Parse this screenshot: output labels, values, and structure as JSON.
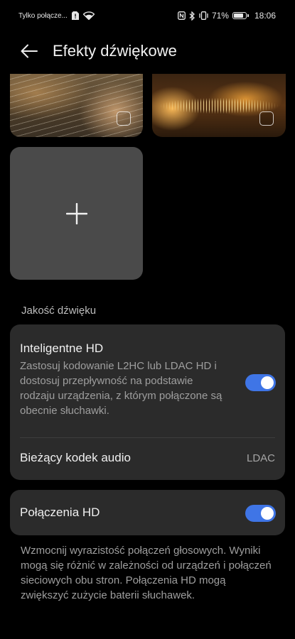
{
  "status_bar": {
    "carrier_text": "Tylko połącze...",
    "battery_percent": "71%",
    "battery_level": 0.71,
    "time": "18:06",
    "icons": [
      "sim-alert-icon",
      "wifi-icon",
      "nfc-icon",
      "bluetooth-icon",
      "vibrate-icon",
      "battery-icon"
    ]
  },
  "header": {
    "title": "Efekty dźwiękowe",
    "back_icon": "arrow-left-icon"
  },
  "effects": {
    "thumbnails": [
      {
        "name": "guitar-effect",
        "checked": false
      },
      {
        "name": "waveform-effect",
        "checked": false
      }
    ],
    "add_icon": "plus-icon"
  },
  "sound_quality": {
    "section_title": "Jakość dźwięku",
    "smart_hd": {
      "title": "Inteligentne HD",
      "description": "Zastosuj kodowanie L2HC lub LDAC HD i dostosuj przepływność na podstawie rodzaju urządzenia, z którym połączone są obecnie słuchawki.",
      "enabled": true
    },
    "codec": {
      "label": "Bieżący kodek audio",
      "value": "LDAC"
    }
  },
  "hd_calls": {
    "label": "Połączenia HD",
    "enabled": true,
    "note": "Wzmocnij wyrazistość połączeń głosowych. Wyniki mogą się różnić w zależności od urządzeń i połączeń sieciowych obu stron. Połączenia HD mogą zwiększyć zużycie baterii słuchawek."
  },
  "colors": {
    "accent": "#3f75e6",
    "card_bg": "#2b2b2b",
    "background": "#000000"
  }
}
